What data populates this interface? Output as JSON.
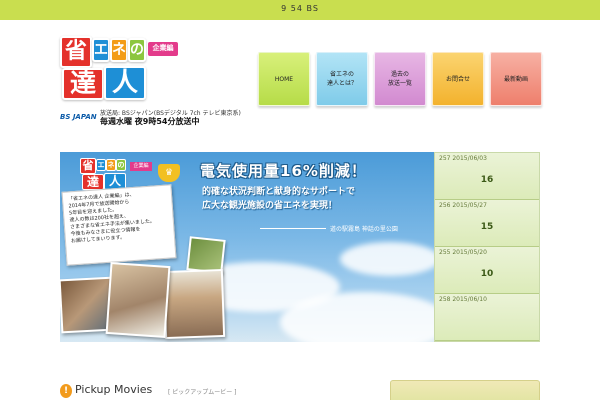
{
  "topbar": {
    "text": "9 54 BS"
  },
  "logo": {
    "sho": "省",
    "e": "エ",
    "ne": "ネ",
    "no": "の",
    "tatsu": "達",
    "hito": "人",
    "edition": "企業編",
    "broadcaster": "BS JAPAN",
    "info_line": "放送局: BSジャパン(BSデジタル 7ch テレビ東京系)",
    "schedule": "毎週水曜 夜9時54分放送中"
  },
  "nav": {
    "items": [
      {
        "label": "HOME"
      },
      {
        "label1": "省エネの",
        "label2": "達人とは？"
      },
      {
        "label1": "過去の",
        "label2": "放送一覧"
      },
      {
        "label": "お問合せ"
      },
      {
        "label": "最新動画"
      }
    ]
  },
  "hero": {
    "badge_sho": "省",
    "badge_e": "エ",
    "badge_ne": "ネ",
    "badge_no": "の",
    "badge_tatsu": "達",
    "badge_hito": "人",
    "badge_edition": "企業編",
    "note_lines": [
      "「省エネの達人 企業編」は、",
      "2014年7月で放送開始から",
      "5年目を迎えました。",
      "達人の数は200社を超え、",
      "さまざまな省エネ手法が集いました。",
      "今後もみなさまに役立つ情報を",
      "お届けしてまいります。"
    ],
    "headline": "電気使用量16%削減！",
    "sub1": "的確な状況判断と献身的なサポートで",
    "sub2": "広大な観光施設の省エネを実現！",
    "place": "道の駅霧島 神話の里公園"
  },
  "episodes": [
    {
      "meta": "257 2015/06/03",
      "number": "16"
    },
    {
      "meta": "256 2015/05/27",
      "number": "15"
    },
    {
      "meta": "255 2015/05/20",
      "number": "10"
    },
    {
      "meta": "258 2015/06/10",
      "number": ""
    }
  ],
  "pickup": {
    "icon": "!",
    "title": "Pickup Movies",
    "subtitle": "[ ピックアップムービー ]"
  }
}
